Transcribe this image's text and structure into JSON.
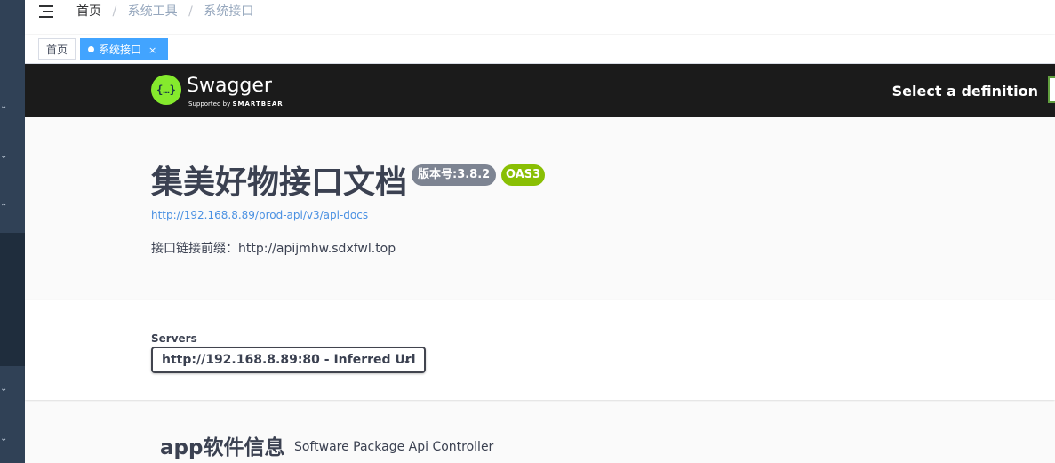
{
  "breadcrumb": {
    "home": "首页",
    "sep": "/",
    "items": [
      "系统工具",
      "系统接口"
    ]
  },
  "tags": [
    {
      "label": "首页"
    },
    {
      "label": "系统接口",
      "close": "×"
    }
  ],
  "swagger": {
    "logo_glyph": "{…}",
    "logo_title": "Swagger",
    "logo_sub_prefix": "Supported by",
    "logo_sub_brand": "SMARTBEAR",
    "select_definition": "Select a definition"
  },
  "info": {
    "title": "集美好物接口文档",
    "version_badge": "版本号:3.8.2",
    "oas_badge": "OAS3",
    "url": "http://192.168.8.89/prod-api/v3/api-docs",
    "description": "接口链接前缀：http://apijmhw.sdxfwl.top"
  },
  "servers": {
    "label": "Servers",
    "selected": "http://192.168.8.89:80 - Inferred Url"
  },
  "section": {
    "title": "app软件信息",
    "subtitle": "Software Package Api Controller"
  },
  "colors": {
    "sidebar": "#304156",
    "tag_active": "#42a4ff",
    "swagger_green": "#85ea2d",
    "oas_green": "#89bf04",
    "version_gray": "#7d8492"
  },
  "icons": [
    "hamburger-icon",
    "chevron-down-icon",
    "chevron-up-icon",
    "close-icon",
    "swagger-logo-icon"
  ]
}
